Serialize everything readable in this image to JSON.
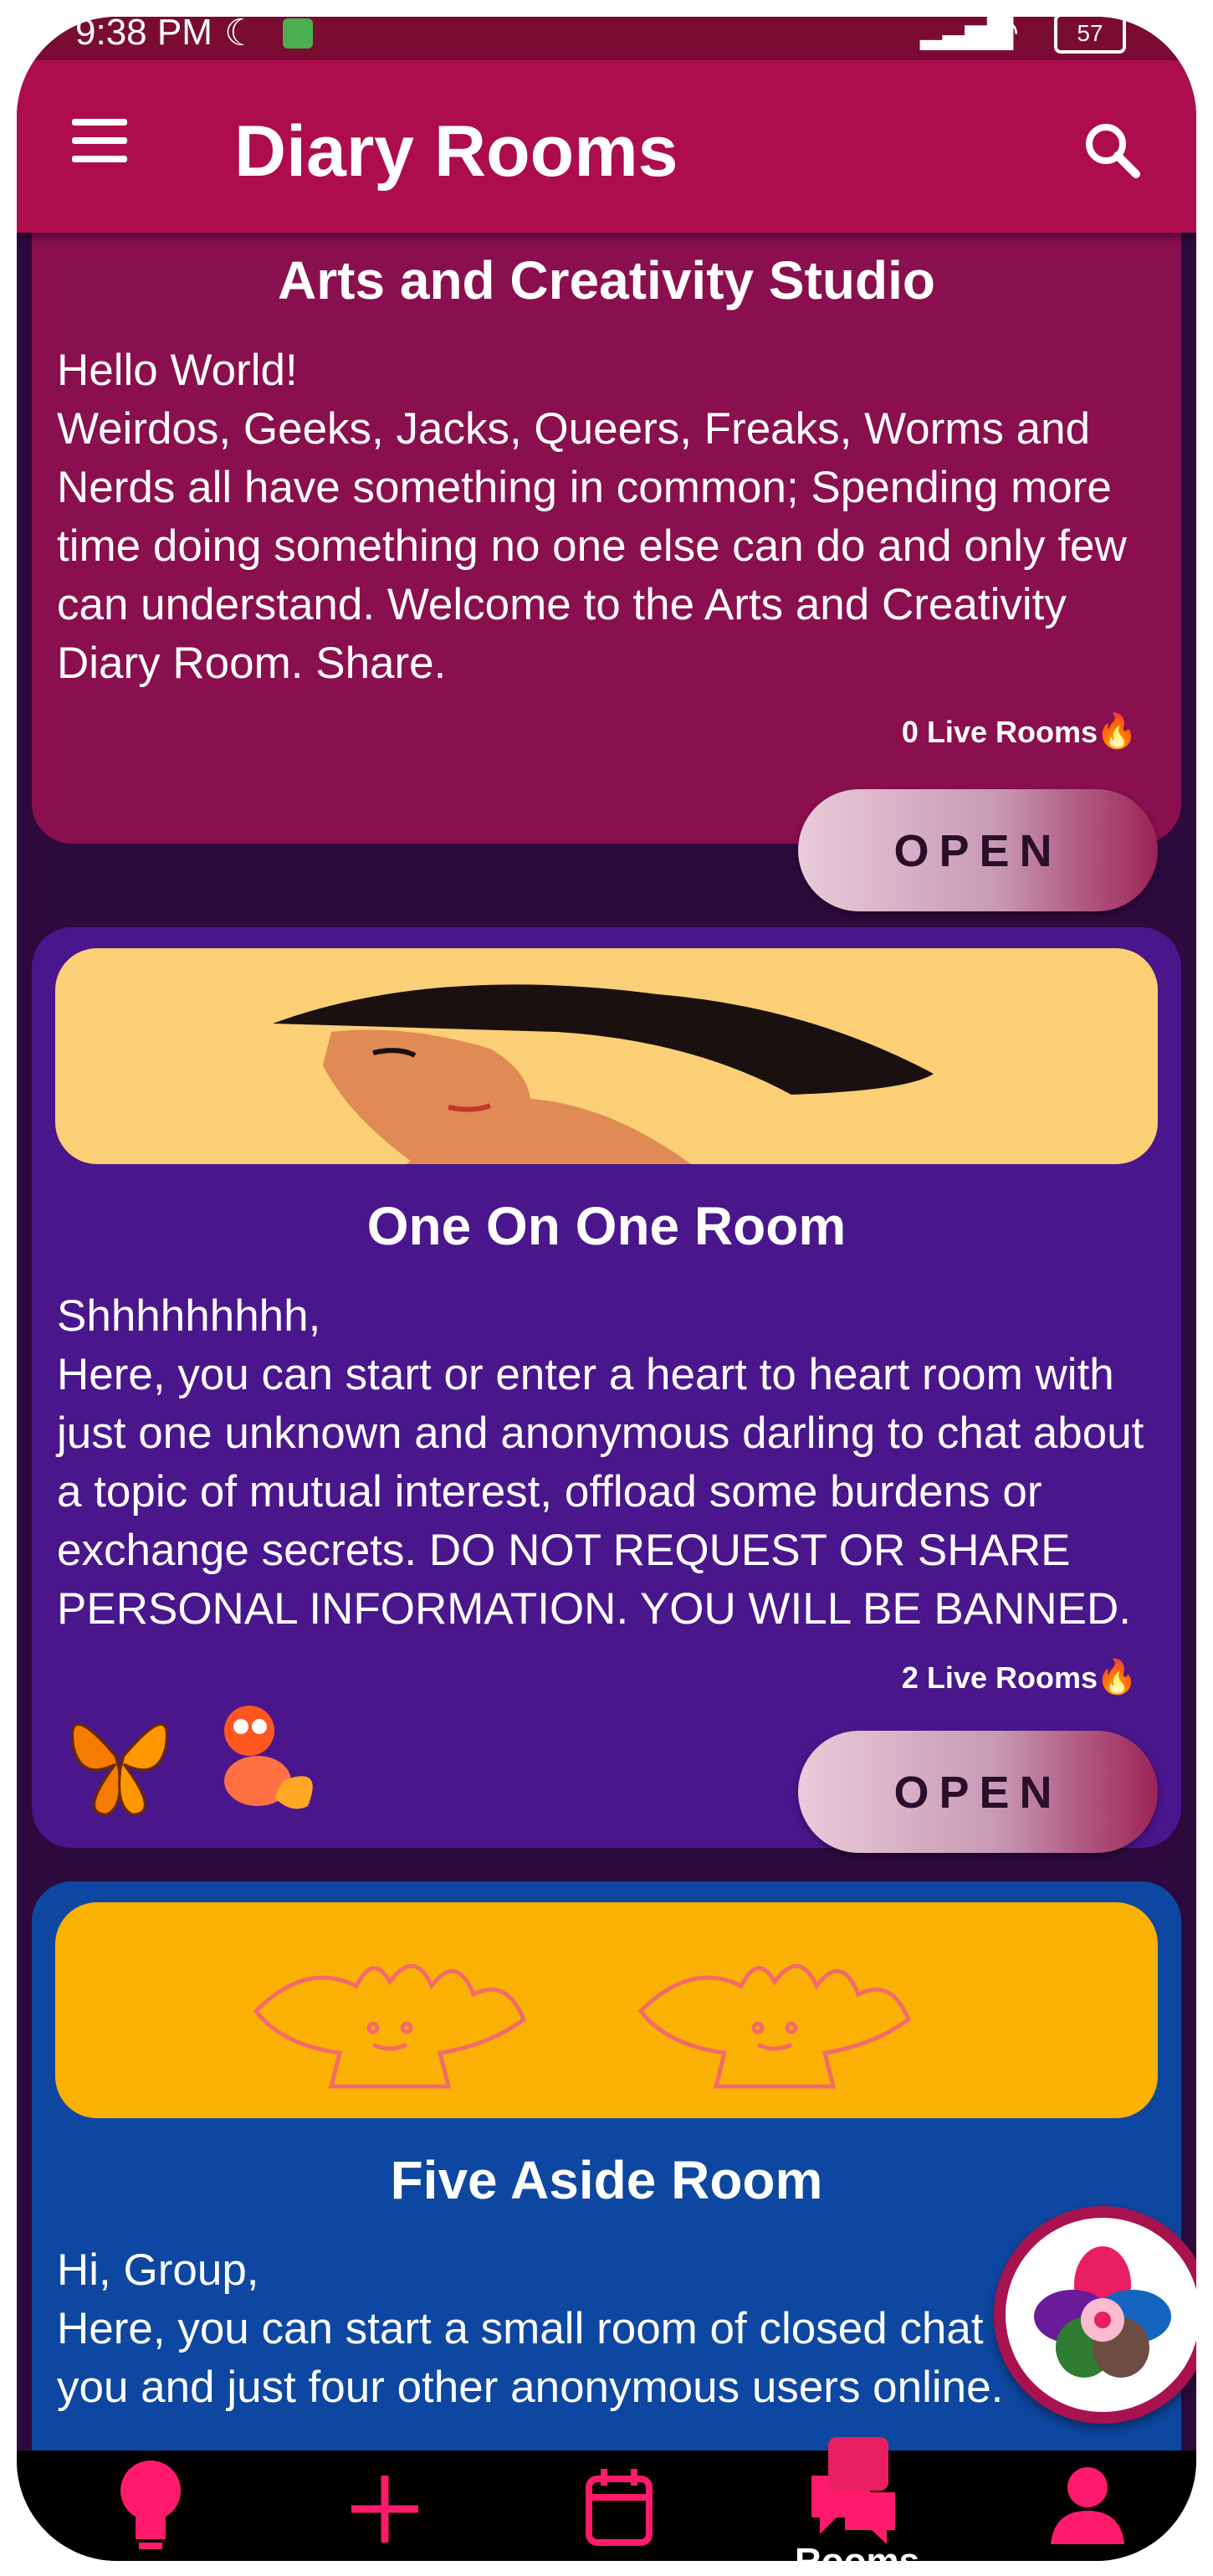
{
  "status_bar": {
    "time": "9:38 PM",
    "battery": "57"
  },
  "app_bar": {
    "title": "Diary Rooms"
  },
  "rooms": [
    {
      "title": "Arts and Creativity Studio",
      "text": [
        "Hello World!",
        "Weirdos, Geeks, Jacks, Queers, Freaks, Worms and",
        "Nerds all have something in common; Spending more",
        "time doing something no one else can do and only few",
        "can understand. Welcome to the Arts and Creativity",
        "Diary Room. Share."
      ],
      "live": "0 Live Rooms",
      "button": "OPEN"
    },
    {
      "title": "One On One Room",
      "text": [
        "Shhhhhhhhh,",
        "Here, you can start or enter a heart to heart room with",
        "just one unknown and anonymous darling to chat about",
        "a topic of mutual interest, offload some burdens or",
        "exchange secrets. DO NOT REQUEST OR SHARE",
        "PERSONAL INFORMATION. YOU WILL BE BANNED."
      ],
      "live": "2 Live Rooms",
      "button": "OPEN"
    },
    {
      "title": "Five Aside Room",
      "text": [
        "Hi, Group,",
        "Here, you can start a small room of closed chat between",
        "you and just four other anonymous users online."
      ]
    }
  ],
  "bottom_nav": {
    "rooms_label": "Rooms"
  },
  "colors": {
    "app_bar": "#ad0d4d",
    "arts_card": "#8a0f4e",
    "one_on_one_card": "#4a168c",
    "five_aside_card": "#0d47a1",
    "nav_icon": "#ff1a6c"
  }
}
